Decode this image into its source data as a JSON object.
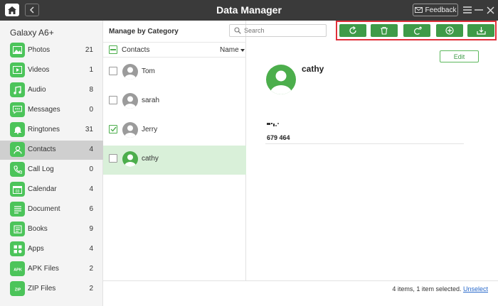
{
  "window": {
    "title": "Data Manager",
    "feedback_label": "Feedback"
  },
  "sidebar": {
    "device_name": "Galaxy A6+",
    "items": [
      {
        "label": "Photos",
        "count": "21",
        "icon": "photo-icon"
      },
      {
        "label": "Videos",
        "count": "1",
        "icon": "video-icon"
      },
      {
        "label": "Audio",
        "count": "8",
        "icon": "music-icon"
      },
      {
        "label": "Messages",
        "count": "0",
        "icon": "message-icon"
      },
      {
        "label": "Ringtones",
        "count": "31",
        "icon": "bell-icon"
      },
      {
        "label": "Contacts",
        "count": "4",
        "icon": "person-icon",
        "active": true
      },
      {
        "label": "Call Log",
        "count": "0",
        "icon": "phone-icon"
      },
      {
        "label": "Calendar",
        "count": "4",
        "icon": "calendar-icon"
      },
      {
        "label": "Document",
        "count": "6",
        "icon": "document-icon"
      },
      {
        "label": "Books",
        "count": "9",
        "icon": "book-icon"
      },
      {
        "label": "Apps",
        "count": "4",
        "icon": "apps-icon"
      },
      {
        "label": "APK Files",
        "count": "2",
        "icon": "apk-icon"
      },
      {
        "label": "ZIP Files",
        "count": "2",
        "icon": "zip-icon"
      }
    ]
  },
  "list": {
    "title": "Manage by Category",
    "header_label": "Contacts",
    "sort_label": "Name",
    "contacts": [
      {
        "name": "Tom",
        "checked": false,
        "selected": false
      },
      {
        "name": "sarah",
        "checked": false,
        "selected": false
      },
      {
        "name": "Jerry",
        "checked": true,
        "selected": false
      },
      {
        "name": "cathy",
        "checked": false,
        "selected": true
      }
    ]
  },
  "search": {
    "placeholder": "Search",
    "value": ""
  },
  "toolbar": {
    "buttons": [
      "refresh-icon",
      "delete-icon",
      "export-to-device-icon",
      "add-icon",
      "export-to-computer-icon"
    ]
  },
  "detail": {
    "name": "cathy",
    "edit_label": "Edit",
    "phone": "679 464"
  },
  "status": {
    "text": "4 items, 1 item selected.",
    "unselect_label": "Unselect"
  },
  "colors": {
    "accent": "#3f9b48",
    "sidebar_icon": "#4cc45a",
    "highlight_box": "#e0303a",
    "selected_row": "#d9f0d9",
    "titlebar": "#3a3a3a"
  }
}
